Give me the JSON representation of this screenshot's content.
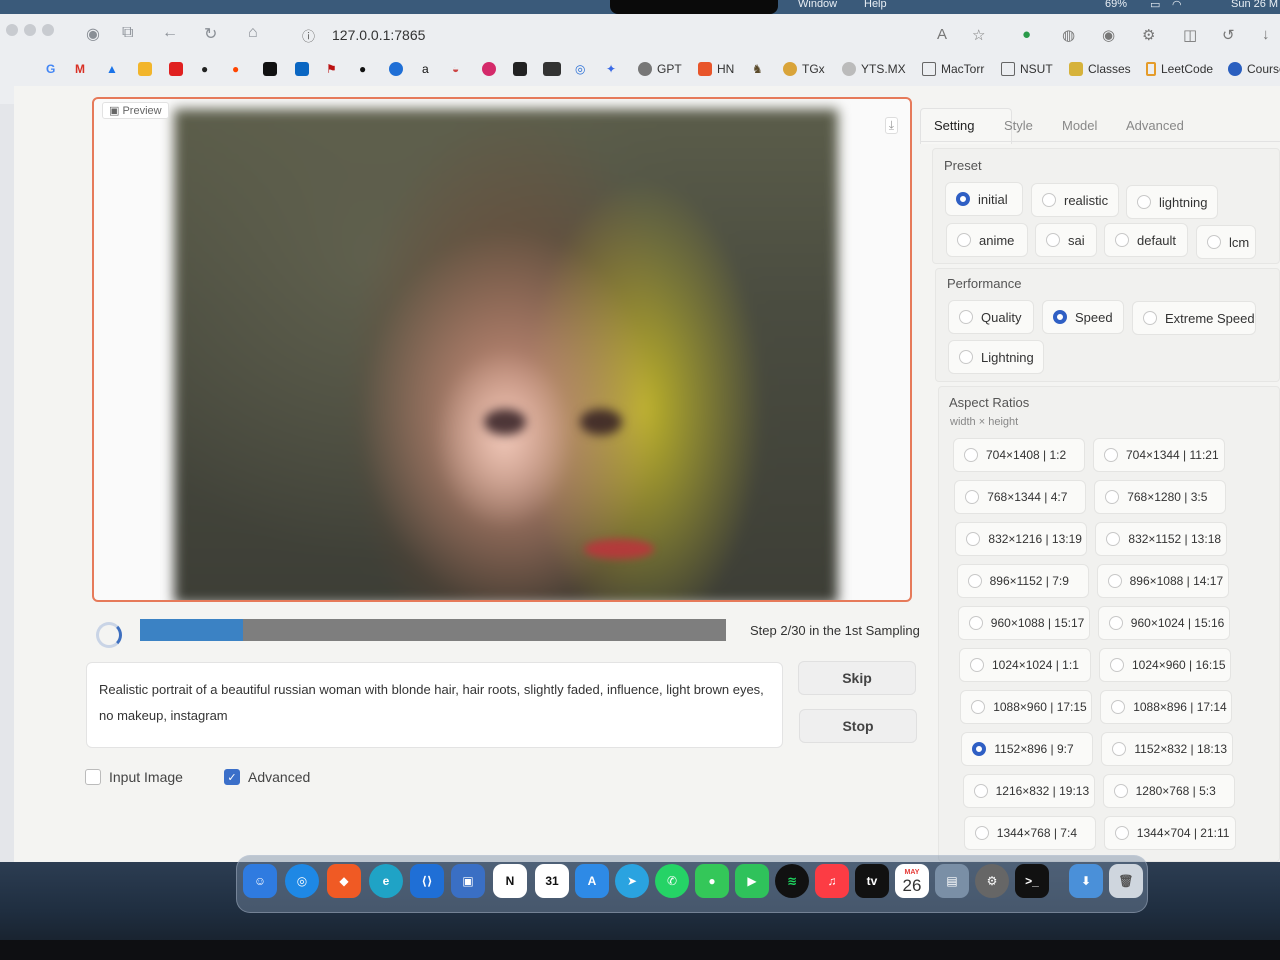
{
  "menubar": {
    "items": [
      "Window",
      "Help"
    ],
    "battery": "69%",
    "clock": "Sun 26 M"
  },
  "browser": {
    "url": "127.0.0.1:7865",
    "bookmarks": [
      {
        "label": "GPT",
        "color": "#777777"
      },
      {
        "label": "HN",
        "color": "#e8552a"
      },
      {
        "label": "TGx",
        "color": "#d9a43a"
      },
      {
        "label": "YTS.MX",
        "color": "#555555"
      },
      {
        "label": "MacTorr",
        "color": "#666666"
      },
      {
        "label": "NSUT",
        "color": "#666666"
      },
      {
        "label": "Classes",
        "color": "#d6b23a"
      },
      {
        "label": "LeetCode",
        "color": "#555555"
      },
      {
        "label": "Courses",
        "color": "#2a5fbf"
      }
    ]
  },
  "preview": {
    "label": "Preview"
  },
  "progress": {
    "step_text": "Step 2/30 in the 1st Sampling",
    "fraction": 0.175
  },
  "prompt": {
    "text": "Realistic portrait of a beautiful russian woman with blonde hair, hair roots, slightly faded, influence, light brown eyes, no makeup, instagram"
  },
  "buttons": {
    "skip": "Skip",
    "stop": "Stop"
  },
  "options": {
    "input_image": {
      "label": "Input Image",
      "checked": false
    },
    "advanced": {
      "label": "Advanced",
      "checked": true
    }
  },
  "tabs": [
    "Setting",
    "Style",
    "Model",
    "Advanced"
  ],
  "preset": {
    "label": "Preset",
    "options": [
      "initial",
      "realistic",
      "lightning",
      "anime",
      "sai",
      "default",
      "lcm"
    ],
    "selected": "initial"
  },
  "performance": {
    "label": "Performance",
    "options": [
      "Quality",
      "Speed",
      "Extreme Speed",
      "Lightning"
    ],
    "selected": "Speed"
  },
  "aspect_ratios": {
    "label": "Aspect Ratios",
    "sublabel": "width × height",
    "options": [
      "704×1408 | 1:2",
      "704×1344 | 11:21",
      "768×1344 | 4:7",
      "768×1280 | 3:5",
      "832×1216 | 13:19",
      "832×1152 | 13:18",
      "896×1152 | 7:9",
      "896×1088 | 14:17",
      "960×1088 | 15:17",
      "960×1024 | 15:16",
      "1024×1024 | 1:1",
      "1024×960 | 16:15",
      "1088×960 | 17:15",
      "1088×896 | 17:14",
      "1152×896 | 9:7",
      "1152×832 | 18:13",
      "1216×832 | 19:13",
      "1280×768 | 5:3",
      "1344×768 | 7:4",
      "1344×704 | 21:11"
    ],
    "selected": "1152×896 | 9:7"
  },
  "dock": {
    "calendar_month": "MAY",
    "calendar_day": "26"
  }
}
